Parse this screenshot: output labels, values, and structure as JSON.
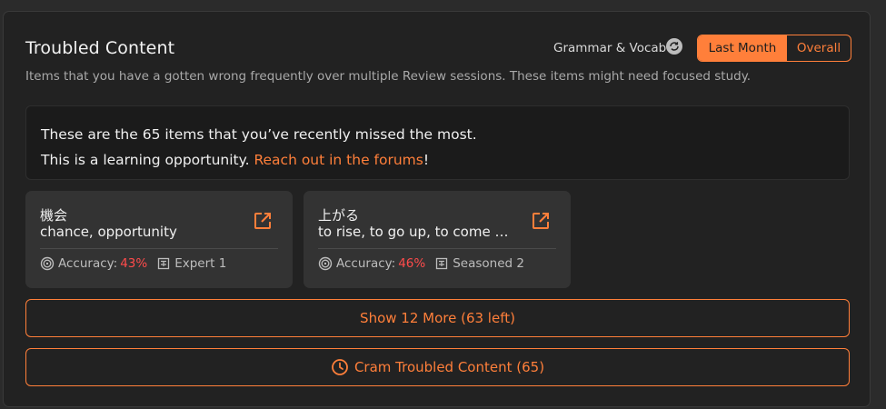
{
  "header": {
    "title": "Troubled Content",
    "subtitle": "Items that you have a gotten wrong frequently over multiple Review sessions. These items might need focused study.",
    "filter_label": "Grammar & Vocab",
    "range_options": [
      "Last Month",
      "Overall"
    ],
    "selected_range": "Last Month"
  },
  "notice": {
    "line1": "These are the 65 items that you’ve recently missed the most.",
    "line2_prefix": "This is a learning opportunity. ",
    "link_text": "Reach out in the forums",
    "line2_suffix": "!"
  },
  "cards": [
    {
      "japanese": "機会",
      "meaning": "chance, opportunity",
      "accuracy_label": "Accuracy:",
      "accuracy": "43%",
      "level": "Expert 1"
    },
    {
      "japanese": "上がる",
      "meaning": "to rise, to go up, to come up, to increase",
      "accuracy_label": "Accuracy:",
      "accuracy": "46%",
      "level": "Seasoned 2"
    }
  ],
  "buttons": {
    "show_more": "Show 12 More (63 left)",
    "cram": "Cram Troubled Content (65)"
  },
  "colors": {
    "accent": "#ff7f3a",
    "danger": "#ff4b4b",
    "panel_bg": "#222222",
    "card_bg": "#333333"
  },
  "icons": {
    "switch": "switch-icon",
    "external_link": "external-link-icon",
    "accuracy": "target-icon",
    "level": "level-badge-icon",
    "clock": "clock-icon"
  }
}
